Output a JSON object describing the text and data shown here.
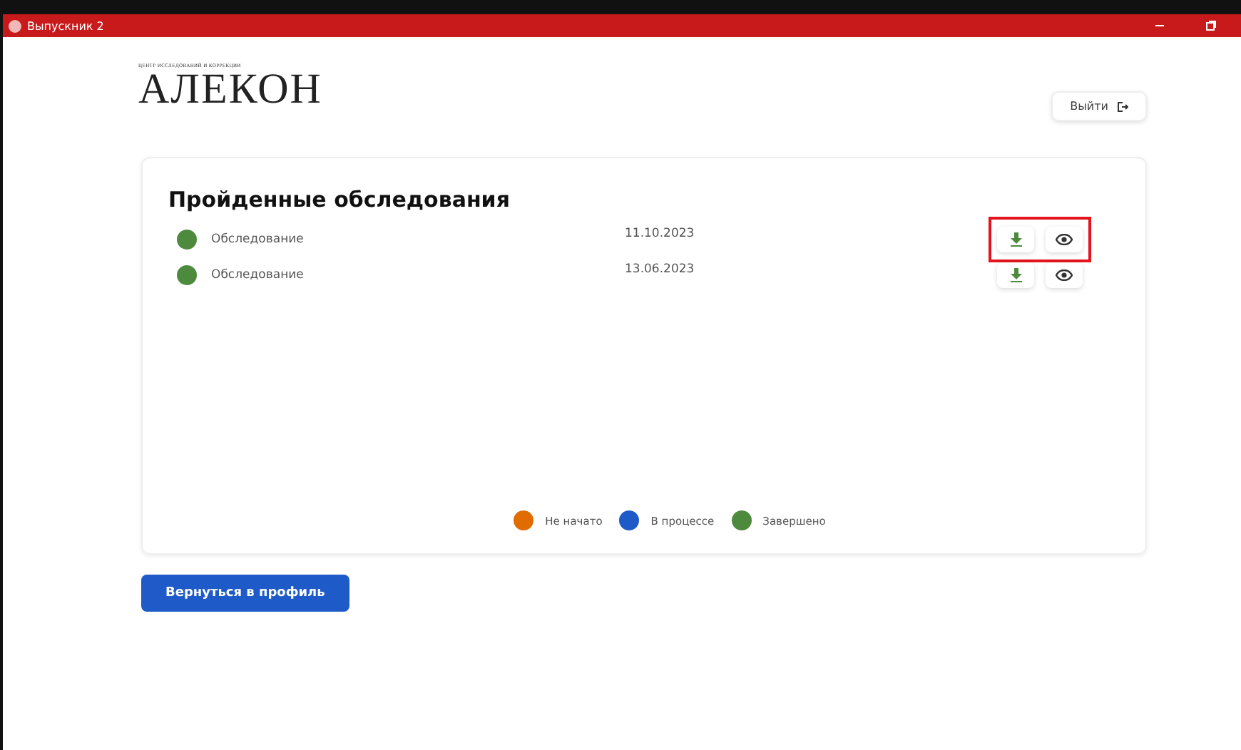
{
  "window": {
    "title": "Выпускник 2"
  },
  "logo": {
    "tagline": "ЦЕНТР ИССЛЕДОВАНИЙ И КОРРЕКЦИИ",
    "text": "АЛЕКОН"
  },
  "logout_button": {
    "label": "Выйти"
  },
  "card": {
    "title": "Пройденные обследования",
    "rows": [
      {
        "name": "Обследование",
        "date": "11.10.2023",
        "color": "#4e8a3e",
        "highlighted": true
      },
      {
        "name": "Обследование",
        "date": "13.06.2023",
        "color": "#4e8a3e",
        "highlighted": false
      }
    ],
    "legend": [
      {
        "label": "Не начато",
        "color": "#e06c00"
      },
      {
        "label": "В процессе",
        "color": "#1f5bc8"
      },
      {
        "label": "Завершено",
        "color": "#4e8a3e"
      }
    ]
  },
  "back_button": {
    "label": "Вернуться в профиль"
  }
}
